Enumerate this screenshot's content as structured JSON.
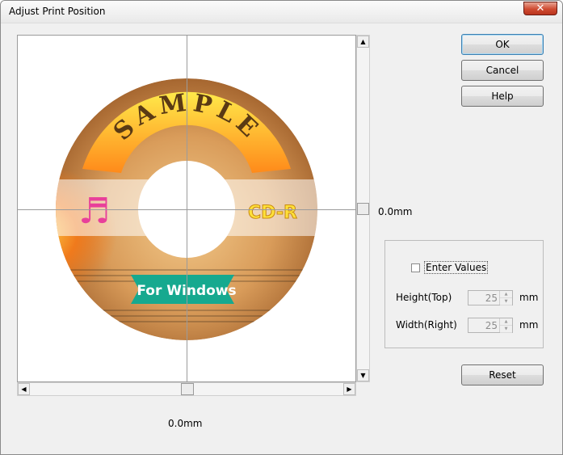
{
  "window": {
    "title": "Adjust Print Position",
    "close_label": "✕"
  },
  "disc": {
    "sample_text": "SAMPLE",
    "cdr_text": "CD-R",
    "windows_text": "For Windows",
    "music_glyph": "♬"
  },
  "scroll": {
    "up": "▲",
    "down": "▼",
    "left": "◀",
    "right": "▶",
    "vertical_readout": "0.0mm",
    "horizontal_readout": "0.0mm"
  },
  "buttons": {
    "ok": "OK",
    "cancel": "Cancel",
    "help": "Help",
    "reset": "Reset"
  },
  "values_panel": {
    "enter_values_label": "Enter Values",
    "enter_values_checked": false,
    "height_label": "Height(Top)",
    "height_value": "25",
    "height_unit": "mm",
    "width_label": "Width(Right)",
    "width_value": "25",
    "width_unit": "mm"
  }
}
